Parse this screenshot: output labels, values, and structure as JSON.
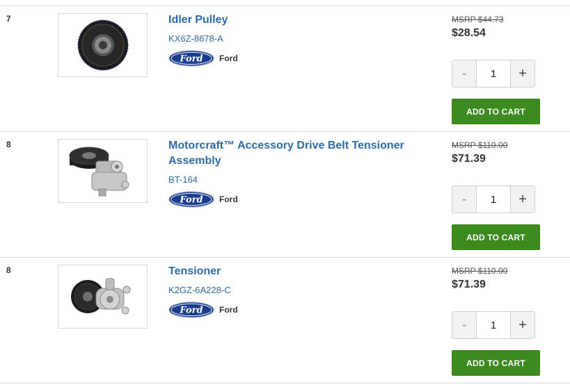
{
  "products": [
    {
      "index": "7",
      "title": "Idler Pulley",
      "part_number": "KX6Z-8678-A",
      "brand": "Ford",
      "msrp": "MSRP $44.73",
      "price": "$28.54",
      "quantity": "1",
      "image_icon": "idler-pulley-icon"
    },
    {
      "index": "8",
      "title": "Motorcraft™ Accessory Drive Belt Tensioner Assembly",
      "part_number": "BT-164",
      "brand": "Ford",
      "msrp": "MSRP $110.00",
      "price": "$71.39",
      "quantity": "1",
      "image_icon": "belt-tensioner-icon"
    },
    {
      "index": "8",
      "title": "Tensioner",
      "part_number": "K2GZ-6A228-C",
      "brand": "Ford",
      "msrp": "MSRP $110.00",
      "price": "$71.39",
      "quantity": "1",
      "image_icon": "tensioner-icon"
    }
  ],
  "controls": {
    "minus_label": "-",
    "plus_label": "+",
    "add_to_cart_label": "ADD TO CART"
  },
  "logo_text": "Ford",
  "colors": {
    "link_blue": "#2f6ba3",
    "cart_green": "#3d8b1f",
    "ford_blue": "#1b3d8f"
  }
}
